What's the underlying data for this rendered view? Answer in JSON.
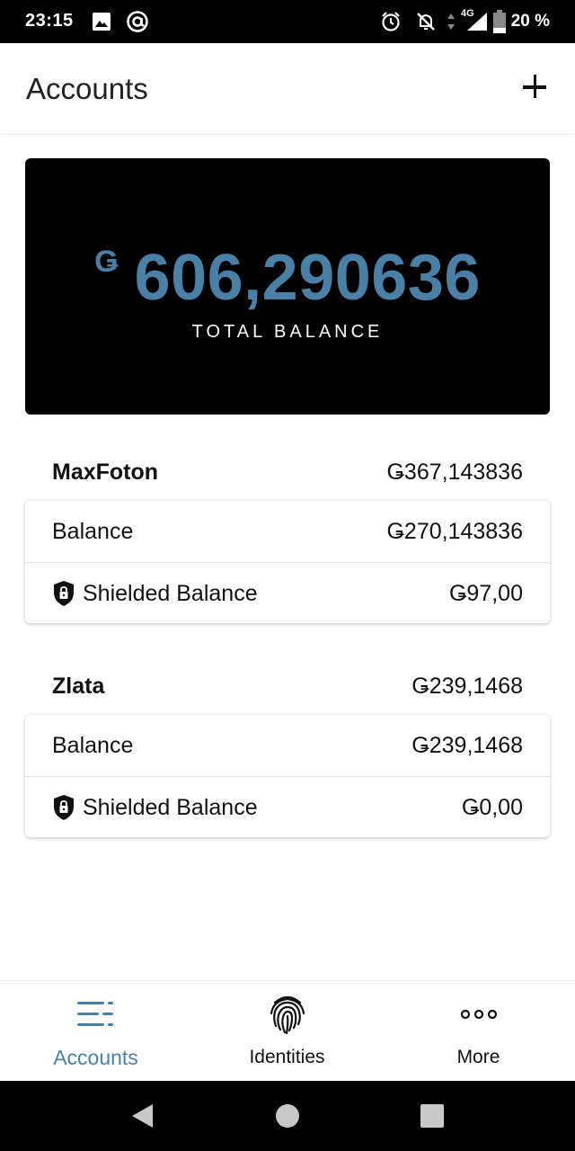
{
  "status_bar": {
    "time": "23:15",
    "network": "4G",
    "battery": "20 %"
  },
  "header": {
    "title": "Accounts"
  },
  "total": {
    "currency": "Ǥ",
    "amount": "606,290636",
    "label": "TOTAL BALANCE"
  },
  "accounts": [
    {
      "name": "MaxFoton",
      "total": "Ǥ367,143836",
      "balance_label": "Balance",
      "balance": "Ǥ270,143836",
      "shielded_label": "Shielded Balance",
      "shielded": "Ǥ97,00"
    },
    {
      "name": "Zlata",
      "total": "Ǥ239,1468",
      "balance_label": "Balance",
      "balance": "Ǥ239,1468",
      "shielded_label": "Shielded Balance",
      "shielded": "Ǥ0,00"
    }
  ],
  "bottom_nav": [
    {
      "label": "Accounts",
      "icon": "accounts-list-icon",
      "active": true
    },
    {
      "label": "Identities",
      "icon": "fingerprint-icon",
      "active": false
    },
    {
      "label": "More",
      "icon": "more-dots-icon",
      "active": false
    }
  ],
  "colors": {
    "accent": "#4a7fa6",
    "card_background": "#000000"
  }
}
